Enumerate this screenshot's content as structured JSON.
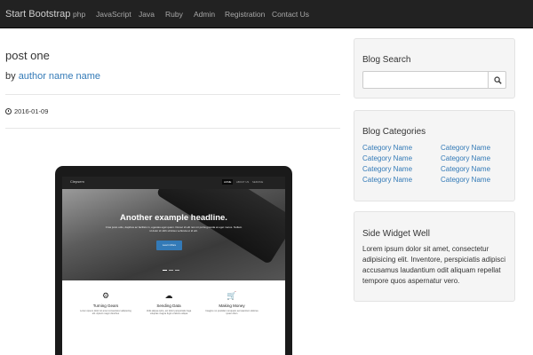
{
  "navbar": {
    "brand": "Start Bootstrap",
    "links": [
      "php",
      "JavaScript",
      "Java",
      "Ruby",
      "Admin",
      "Registration",
      "Contact Us"
    ]
  },
  "post": {
    "title": "post one",
    "by_prefix": "by",
    "author": "author name name",
    "date": "2016-01-09"
  },
  "preview": {
    "brand": "Clepsem",
    "links": [
      "HOME",
      "ABOUT US",
      "SERVICE"
    ],
    "headline": "Another example headline.",
    "subtext": "Cras justo odio, dapibus ac facilisis in, egestas eget quam. Donec id elit non mi porta gravida at eget metus. Nullam id dolor id nibh ultricies vehicula ut id elit.",
    "button": "Learn More",
    "features": [
      {
        "icon": "gear-icon",
        "title": "Turning Gears",
        "text": "Lorem ipsum dolor sit amet consectetur adipiscing elit. Aptent magni dicerbus"
      },
      {
        "icon": "cloud-icon",
        "title": "Sending Data",
        "text": "Velis aliqua optio, est dolor perspiciatis fuga voluptas magna fugit ut labore aliqua"
      },
      {
        "icon": "cart-icon",
        "title": "Making Money",
        "text": "Imagine no postidet numquam accusantium dolores ipsam illum"
      }
    ]
  },
  "sidebar": {
    "search": {
      "title": "Blog Search",
      "value": "",
      "placeholder": ""
    },
    "categories": {
      "title": "Blog Categories",
      "left": [
        "Category Name",
        "Category Name",
        "Category Name",
        "Category Name"
      ],
      "right": [
        "Category Name",
        "Category Name",
        "Category Name",
        "Category Name"
      ]
    },
    "widget": {
      "title": "Side Widget Well",
      "text": "Lorem ipsum dolor sit amet, consectetur adipisicing elit. Inventore, perspiciatis adipisci accusamus laudantium odit aliquam repellat tempore quos aspernatur vero."
    }
  },
  "colors": {
    "navbar": "#222222",
    "link": "#337ab7",
    "well": "#f5f5f5",
    "button": "#337ab7"
  }
}
